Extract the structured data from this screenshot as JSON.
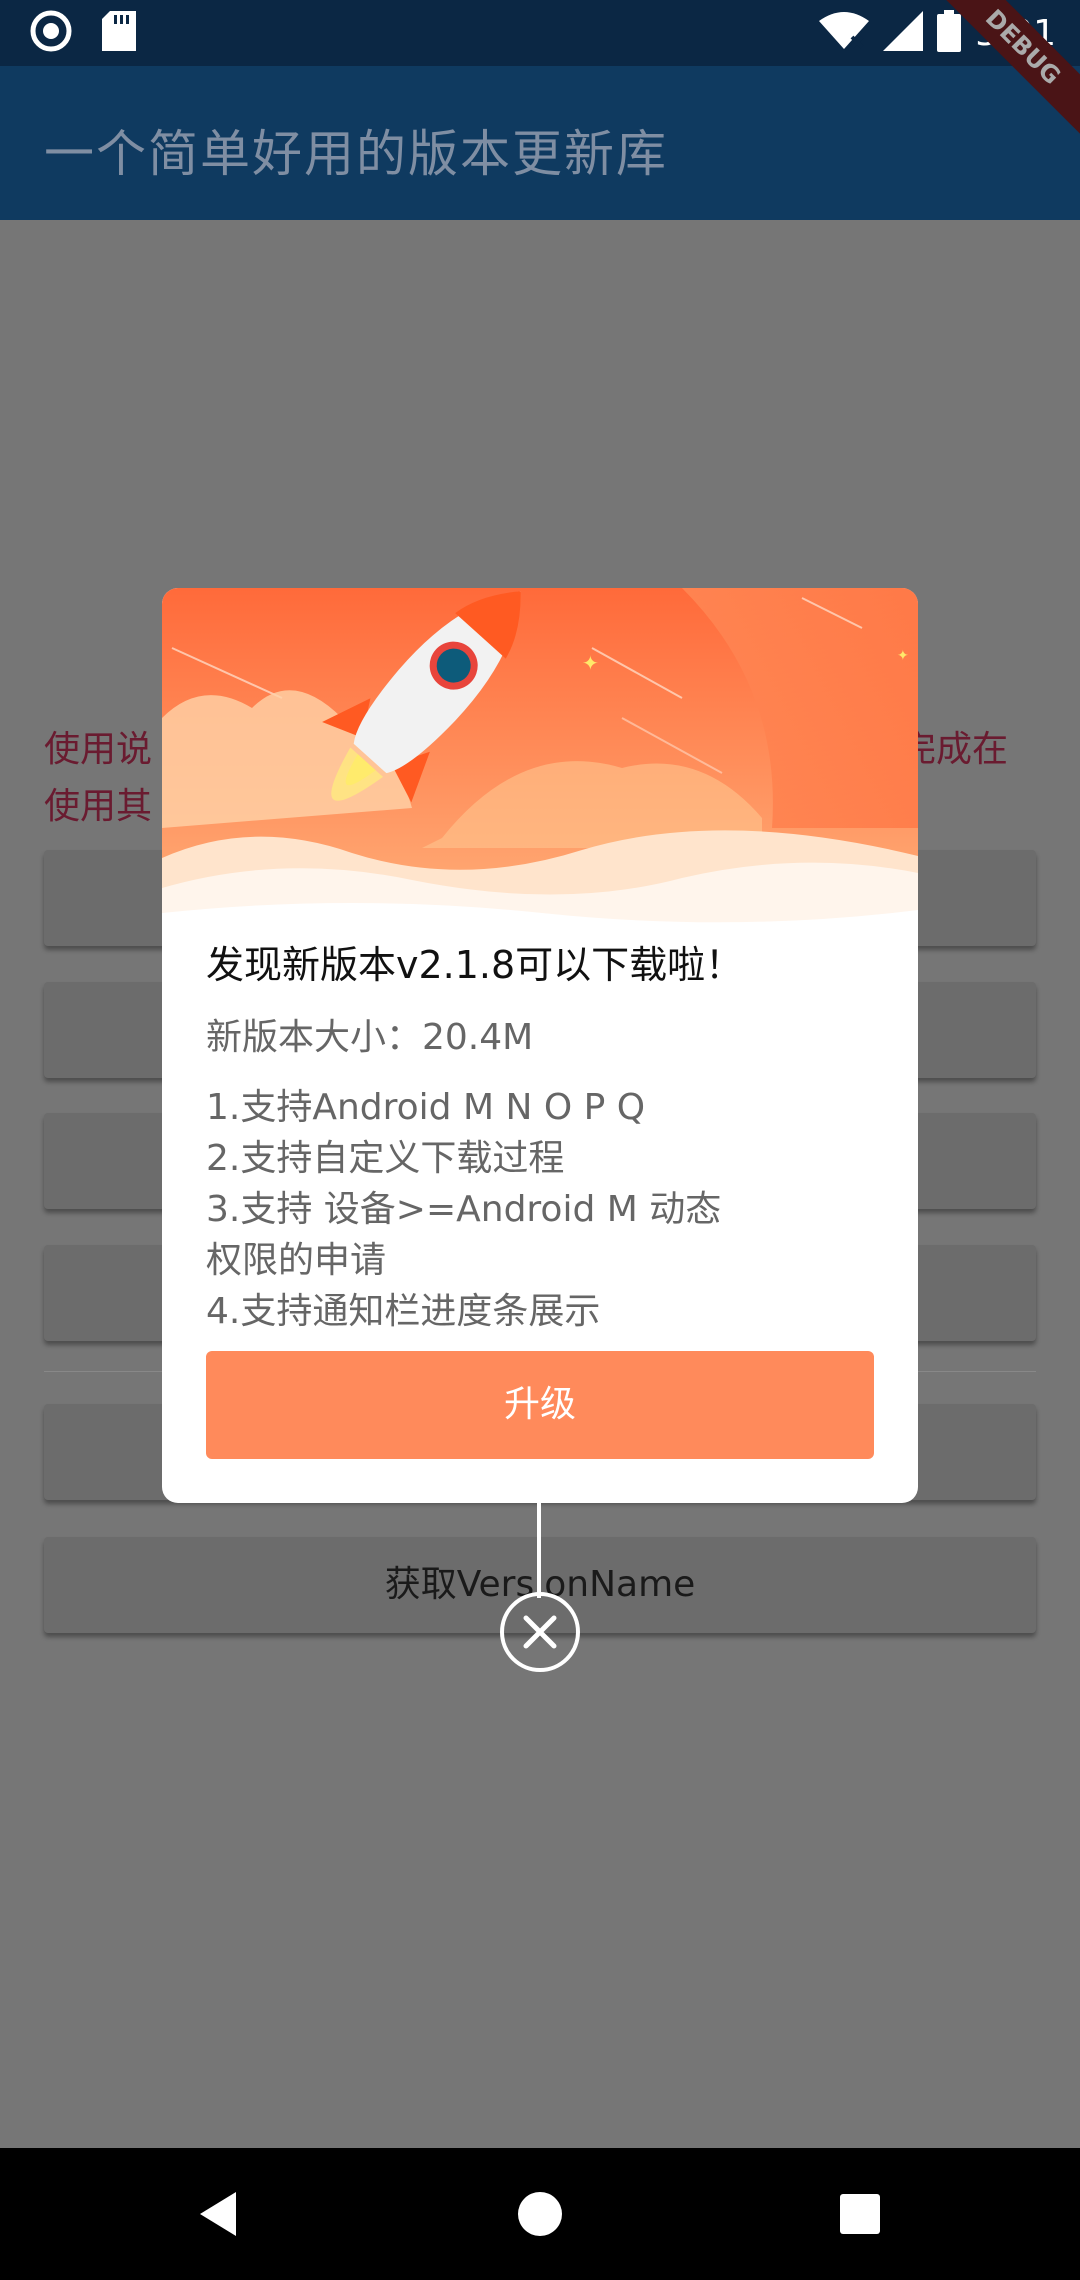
{
  "status_bar": {
    "time": "5:01",
    "left_icons": [
      "record-icon",
      "sd-card-icon"
    ],
    "right_icons": [
      "wifi-icon",
      "signal-icon",
      "battery-icon"
    ]
  },
  "app_bar": {
    "title": "一个简单好用的版本更新库",
    "debug_banner": "DEBUG"
  },
  "background": {
    "usage_line1_left": "使用说",
    "usage_line1_right": "完成在",
    "usage_line2_left": "使用其",
    "last_button_label": "获取VersionName"
  },
  "dialog": {
    "title": "发现新版本v2.1.8可以下载啦！",
    "size_text": "新版本大小：20.4M",
    "notes": [
      "1.支持Android M N O P Q",
      "2.支持自定义下载过程",
      "3.支持 设备>=Android M 动态",
      "权限的申请",
      "4.支持通知栏进度条展示"
    ],
    "upgrade_label": "升级",
    "colors": {
      "accent": "#ff8a5b",
      "header_top": "#ff6a3a",
      "header_bottom": "#ffb07a"
    }
  },
  "nav_bar": {
    "icons": [
      "back-icon",
      "home-icon",
      "recents-icon"
    ]
  }
}
